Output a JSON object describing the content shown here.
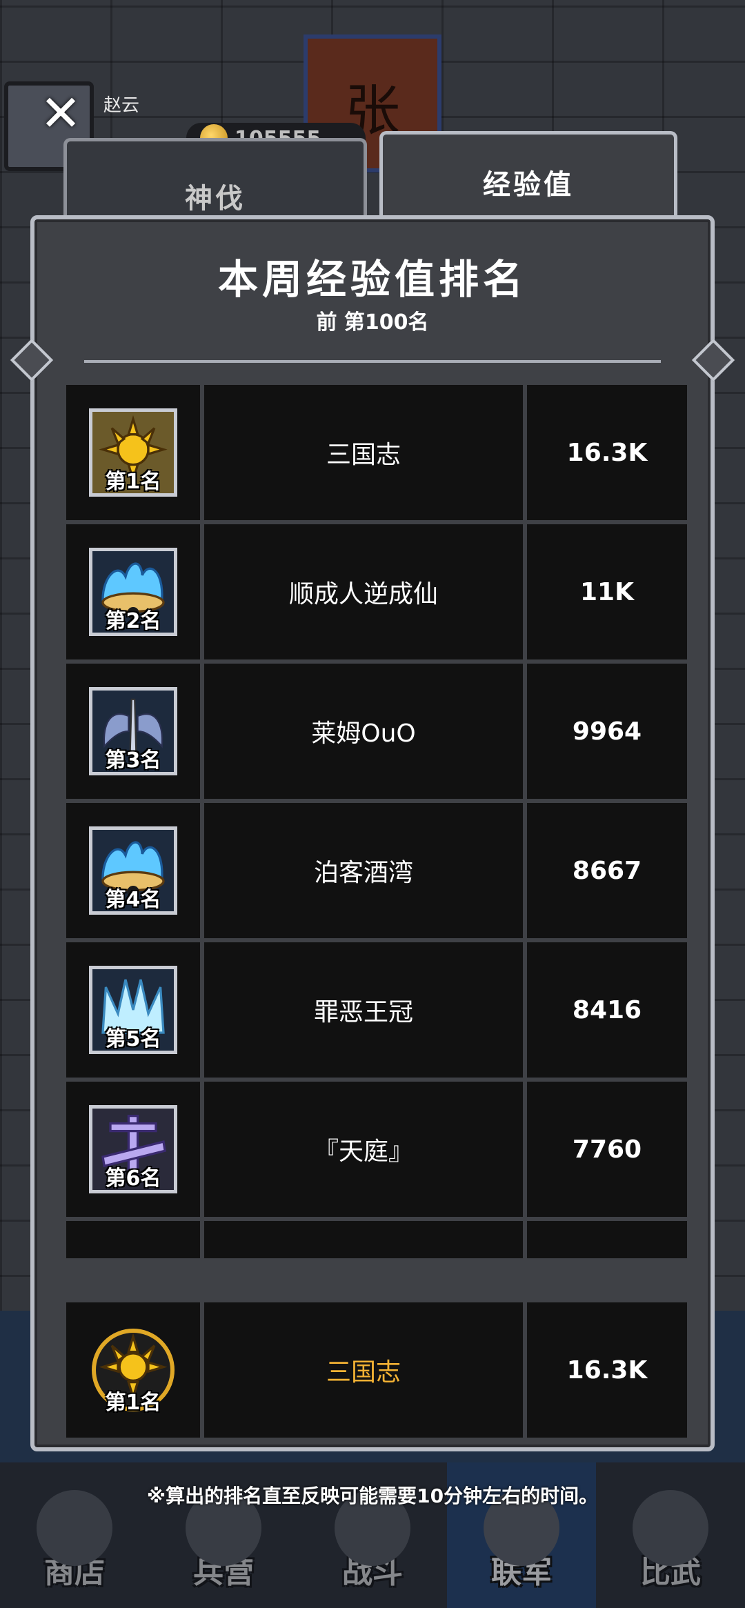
{
  "hero": {
    "name": "赵云",
    "coins": "105555"
  },
  "background": {
    "banner_char": "张"
  },
  "tabs": [
    {
      "label": "神伐",
      "active": false
    },
    {
      "label": "经验值",
      "active": true
    }
  ],
  "panel": {
    "title": "本周经验值排名",
    "subtitle": "前 第100名"
  },
  "rankings": [
    {
      "rank_label": "第1名",
      "name": "三国志",
      "score": "16.3K",
      "icon": "sun-icon"
    },
    {
      "rank_label": "第2名",
      "name": "顺成人逆成仙",
      "score": "11K",
      "icon": "blue-flame-icon"
    },
    {
      "rank_label": "第3名",
      "name": "莱姆OuO",
      "score": "9964",
      "icon": "winged-sword-icon"
    },
    {
      "rank_label": "第4名",
      "name": "泊客酒湾",
      "score": "8667",
      "icon": "blue-flame-icon"
    },
    {
      "rank_label": "第5名",
      "name": "罪恶王冠",
      "score": "8416",
      "icon": "ice-crown-icon"
    },
    {
      "rank_label": "第6名",
      "name": "『天庭』",
      "score": "7760",
      "icon": "crossed-swords-icon"
    }
  ],
  "self_rank": {
    "rank_label": "第1名",
    "name": "三国志",
    "score": "16.3K",
    "icon": "sun-icon"
  },
  "note": "※算出的排名直至反映可能需要10分钟左右的时间。",
  "bottom_nav": [
    {
      "label": "商店",
      "active": false
    },
    {
      "label": "兵营",
      "active": false
    },
    {
      "label": "战斗",
      "active": false
    },
    {
      "label": "联军",
      "active": true
    },
    {
      "label": "比武",
      "active": false
    }
  ],
  "colors": {
    "self_name": "#f3b234",
    "frame": "#b9bdc6"
  }
}
